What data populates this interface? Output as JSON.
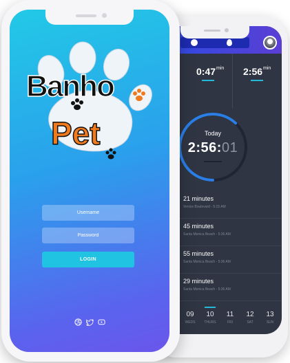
{
  "back_screen": {
    "stats": [
      {
        "value": "",
        "unit": ""
      },
      {
        "value": "0:47",
        "unit": "min"
      },
      {
        "value": "2:56",
        "unit": "min"
      }
    ],
    "today": {
      "label": "Today",
      "time_main": "2:56:",
      "time_dim": "01",
      "progress": 0.62
    },
    "sessions": [
      {
        "duration": "21 minutes",
        "location": "Venice Boulevard - 5:15 AM"
      },
      {
        "duration": "45 minutes",
        "location": "Santa Monica Beach - 5:36 AM"
      },
      {
        "duration": "55 minutes",
        "location": "Santa Monica Beach - 5:36 AM"
      },
      {
        "duration": "29 minutes",
        "location": "Santa Monica Beach - 5:36 AM"
      }
    ],
    "days": [
      {
        "num": "09",
        "label": "WEDS",
        "selected": false
      },
      {
        "num": "10",
        "label": "THURS",
        "selected": true
      },
      {
        "num": "11",
        "label": "FRI",
        "selected": false
      },
      {
        "num": "12",
        "label": "SAT",
        "selected": false
      },
      {
        "num": "13",
        "label": "SUN",
        "selected": false
      }
    ],
    "accent": "#24b9d8",
    "background": "#2f3542"
  },
  "front_screen": {
    "logo": {
      "word1": "Banho",
      "word2": "Pet"
    },
    "username_placeholder": "Username",
    "password_placeholder": "Password",
    "login_label": "LOGIN",
    "social_icons": [
      "dribbble-icon",
      "twitter-icon",
      "youtube-icon"
    ],
    "gradient": [
      "#22c9e6",
      "#6a56ec"
    ],
    "button_color": "#20c4e2"
  }
}
